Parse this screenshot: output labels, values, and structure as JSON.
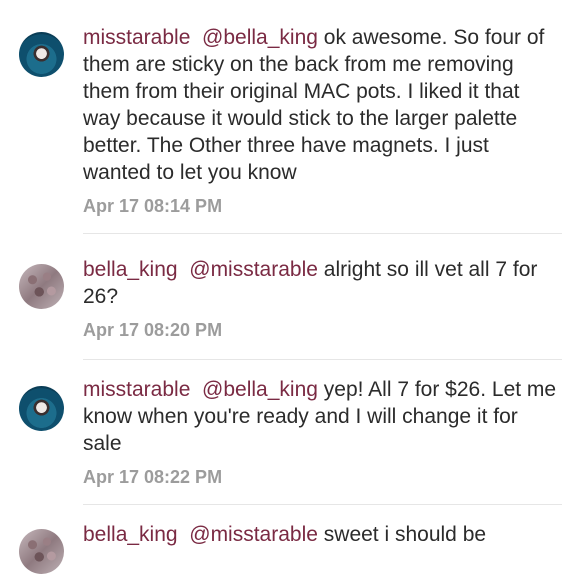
{
  "comments": [
    {
      "username": "misstarable",
      "mention": "@bella_king",
      "body": "ok awesome. So four of them are sticky on the back from me removing them from their original MAC pots. I liked it that way because it would stick to the larger palette better. The Other three have magnets. I just wanted to let you know",
      "timestamp": "Apr 17 08:14 PM"
    },
    {
      "username": "bella_king",
      "mention": "@misstarable",
      "body": "alright so ill vet all 7 for 26?",
      "timestamp": "Apr 17 08:20 PM"
    },
    {
      "username": "misstarable",
      "mention": "@bella_king",
      "body": "yep! All 7 for $26. Let me know when you're ready and I will change it for sale",
      "timestamp": "Apr 17 08:22 PM"
    },
    {
      "username": "bella_king",
      "mention": "@misstarable",
      "body": "sweet i should be",
      "timestamp": ""
    }
  ]
}
